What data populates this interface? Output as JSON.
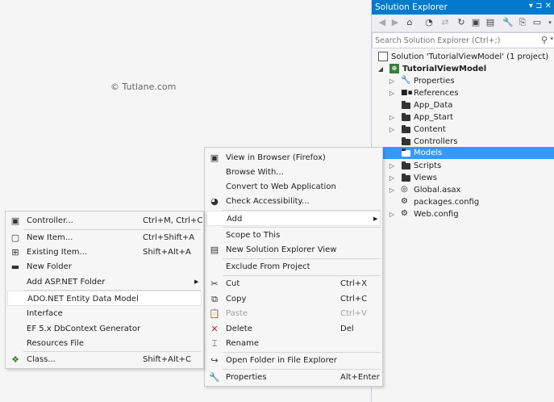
{
  "watermark": "© Tutlane.com",
  "solution_explorer": {
    "title": "Solution Explorer",
    "title_tools": "▾ ⊐ ✕",
    "search_placeholder": "Search Solution Explorer (Ctrl+;)",
    "tree": [
      {
        "label": "Solution 'TutorialViewModel' (1 project)",
        "icon": "solution-icon"
      },
      {
        "label": "TutorialViewModel",
        "icon": "csharp-project-icon",
        "bold": true
      },
      {
        "label": "Properties",
        "icon": "wrench-icon"
      },
      {
        "label": "References",
        "icon": "references-icon"
      },
      {
        "label": "App_Data",
        "icon": "folder-icon"
      },
      {
        "label": "App_Start",
        "icon": "folder-icon"
      },
      {
        "label": "Content",
        "icon": "folder-icon"
      },
      {
        "label": "Controllers",
        "icon": "folder-icon"
      },
      {
        "label": "Models",
        "icon": "folder-icon",
        "selected": true
      },
      {
        "label": "Scripts",
        "icon": "folder-icon"
      },
      {
        "label": "Views",
        "icon": "folder-icon"
      },
      {
        "label": "Global.asax",
        "icon": "global-asax-icon"
      },
      {
        "label": "packages.config",
        "icon": "config-file-icon"
      },
      {
        "label": "Web.config",
        "icon": "web-config-icon"
      }
    ]
  },
  "context_menu": {
    "items": [
      {
        "label": "View in Browser (Firefox)",
        "shortcut": ""
      },
      {
        "label": "Browse With...",
        "shortcut": ""
      },
      {
        "label": "Convert to Web Application",
        "shortcut": ""
      },
      {
        "label": "Check Accessibility...",
        "shortcut": ""
      },
      {
        "label": "Add",
        "shortcut": ""
      },
      {
        "label": "Scope to This",
        "shortcut": ""
      },
      {
        "label": "New Solution Explorer View",
        "shortcut": ""
      },
      {
        "label": "Exclude From Project",
        "shortcut": ""
      },
      {
        "label": "Cut",
        "shortcut": "Ctrl+X"
      },
      {
        "label": "Copy",
        "shortcut": "Ctrl+C"
      },
      {
        "label": "Paste",
        "shortcut": "Ctrl+V"
      },
      {
        "label": "Delete",
        "shortcut": "Del"
      },
      {
        "label": "Rename",
        "shortcut": ""
      },
      {
        "label": "Open Folder in File Explorer",
        "shortcut": ""
      },
      {
        "label": "Properties",
        "shortcut": "Alt+Enter"
      }
    ]
  },
  "add_submenu": {
    "items": [
      {
        "label": "Controller...",
        "shortcut": "Ctrl+M, Ctrl+C"
      },
      {
        "label": "New Item...",
        "shortcut": "Ctrl+Shift+A"
      },
      {
        "label": "Existing Item...",
        "shortcut": "Shift+Alt+A"
      },
      {
        "label": "New Folder",
        "shortcut": ""
      },
      {
        "label": "Add ASP.NET Folder",
        "shortcut": ""
      },
      {
        "label": "ADO.NET Entity Data Model",
        "shortcut": ""
      },
      {
        "label": "Interface",
        "shortcut": ""
      },
      {
        "label": "EF 5.x DbContext Generator",
        "shortcut": ""
      },
      {
        "label": "Resources File",
        "shortcut": ""
      },
      {
        "label": "Class...",
        "shortcut": "Shift+Alt+C"
      }
    ]
  },
  "colors": {
    "accent": "#007acc",
    "selection": "#3399ff",
    "menu_bg": "#f6f6f6",
    "disabled": "#a2a4a5"
  }
}
